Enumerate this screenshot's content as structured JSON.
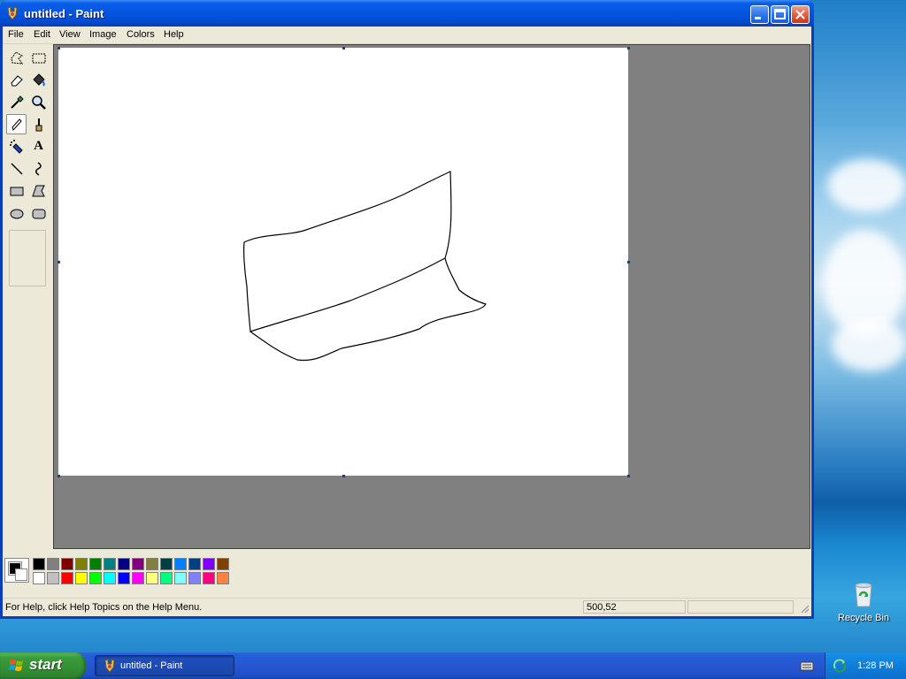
{
  "window": {
    "title": "untitled - Paint"
  },
  "menu": [
    "File",
    "Edit",
    "View",
    "Image",
    "Colors",
    "Help"
  ],
  "tools": [
    {
      "name": "free-form-select-icon"
    },
    {
      "name": "select-icon"
    },
    {
      "name": "eraser-icon"
    },
    {
      "name": "fill-with-color-icon"
    },
    {
      "name": "pick-color-icon"
    },
    {
      "name": "magnifier-icon"
    },
    {
      "name": "pencil-icon",
      "selected": true
    },
    {
      "name": "brush-icon"
    },
    {
      "name": "airbrush-icon"
    },
    {
      "name": "text-icon",
      "glyph": "A"
    },
    {
      "name": "line-icon"
    },
    {
      "name": "curve-icon"
    },
    {
      "name": "rectangle-icon"
    },
    {
      "name": "polygon-icon"
    },
    {
      "name": "ellipse-icon"
    },
    {
      "name": "rounded-rectangle-icon"
    }
  ],
  "palette": {
    "top": [
      "#000000",
      "#808080",
      "#800000",
      "#808000",
      "#008000",
      "#008080",
      "#000080",
      "#800080",
      "#808040",
      "#004040",
      "#0080ff",
      "#004080",
      "#8000ff",
      "#804000"
    ],
    "bottom": [
      "#ffffff",
      "#c0c0c0",
      "#ff0000",
      "#ffff00",
      "#00ff00",
      "#00ffff",
      "#0000ff",
      "#ff00ff",
      "#ffff80",
      "#00ff80",
      "#80ffff",
      "#8080ff",
      "#ff0080",
      "#ff8040"
    ],
    "foreground": "#000000",
    "background": "#ffffff"
  },
  "status": {
    "help": "For Help, click Help Topics on the Help Menu.",
    "coords": "500,52"
  },
  "desktop": {
    "recycle_bin": "Recycle Bin"
  },
  "taskbar": {
    "start": "start",
    "task": "untitled - Paint",
    "clock": "1:28 PM"
  }
}
